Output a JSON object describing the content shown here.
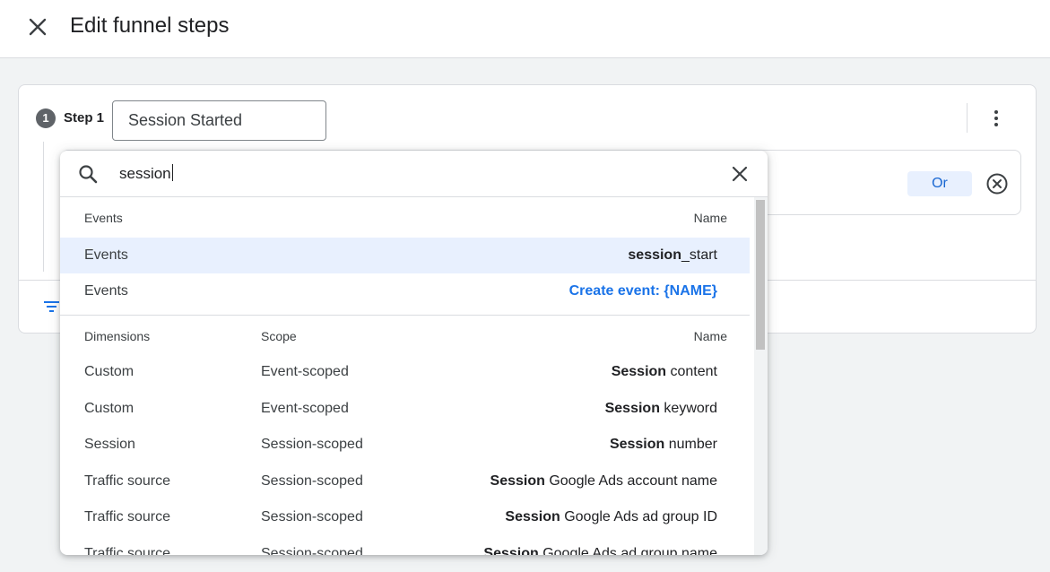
{
  "header": {
    "title": "Edit funnel steps"
  },
  "step": {
    "number": "1",
    "label": "Step 1",
    "name": "Session Started",
    "or_label": "Or"
  },
  "search": {
    "query": "session"
  },
  "events_section": {
    "header_left": "Events",
    "header_right": "Name",
    "rows": [
      {
        "category": "Events",
        "name_bold": "session",
        "name_rest": "_start"
      },
      {
        "category": "Events",
        "create_label": "Create event: {NAME}"
      }
    ]
  },
  "dimensions_section": {
    "header_left": "Dimensions",
    "header_scope": "Scope",
    "header_right": "Name",
    "rows": [
      {
        "category": "Custom",
        "scope": "Event-scoped",
        "name_bold": "Session",
        "name_rest": " content"
      },
      {
        "category": "Custom",
        "scope": "Event-scoped",
        "name_bold": "Session",
        "name_rest": " keyword"
      },
      {
        "category": "Session",
        "scope": "Session-scoped",
        "name_bold": "Session",
        "name_rest": " number"
      },
      {
        "category": "Traffic source",
        "scope": "Session-scoped",
        "name_bold": "Session",
        "name_rest": " Google Ads account name"
      },
      {
        "category": "Traffic source",
        "scope": "Session-scoped",
        "name_bold": "Session",
        "name_rest": " Google Ads ad group ID"
      },
      {
        "category": "Traffic source",
        "scope": "Session-scoped",
        "name_bold": "Session",
        "name_rest": " Google Ads ad group name"
      }
    ]
  },
  "colors": {
    "accent": "#1a73e8",
    "selected_bg": "#e8f0fe",
    "or_bg": "#e8f0fe",
    "step_badge": "#5f6368"
  },
  "icons": [
    "close-icon",
    "more-vert-icon",
    "cancel-circle-icon",
    "filter-icon",
    "search-icon",
    "clear-icon"
  ]
}
